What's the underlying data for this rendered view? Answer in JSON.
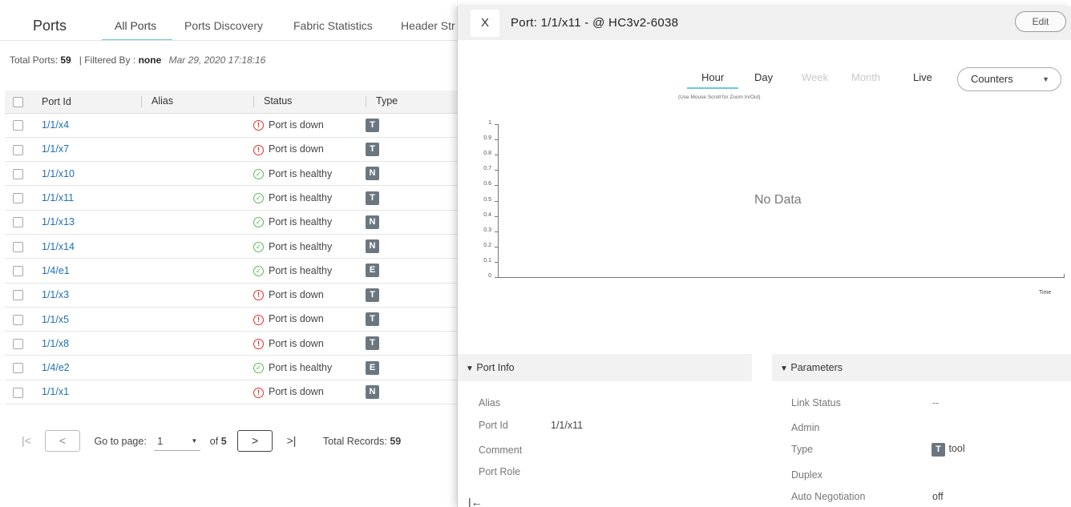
{
  "app": {
    "title": "Ports",
    "tabs": [
      "All Ports",
      "Ports Discovery",
      "Fabric Statistics",
      "Header Str"
    ],
    "summary": {
      "total_label": "Total Ports:",
      "total_value": "59",
      "filter_label": "| Filtered By :",
      "filter_value": "none",
      "timestamp": "Mar 29, 2020 17:18:16"
    }
  },
  "table": {
    "headers": {
      "port_id": "Port Id",
      "alias": "Alias",
      "status": "Status",
      "type": "Type"
    },
    "rows": [
      {
        "port": "1/1/x4",
        "status": "Port is down",
        "state": "down",
        "type": "T"
      },
      {
        "port": "1/1/x7",
        "status": "Port is down",
        "state": "down",
        "type": "T"
      },
      {
        "port": "1/1/x10",
        "status": "Port is healthy",
        "state": "ok",
        "type": "N"
      },
      {
        "port": "1/1/x11",
        "status": "Port is healthy",
        "state": "ok",
        "type": "T"
      },
      {
        "port": "1/1/x13",
        "status": "Port is healthy",
        "state": "ok",
        "type": "N"
      },
      {
        "port": "1/1/x14",
        "status": "Port is healthy",
        "state": "ok",
        "type": "N"
      },
      {
        "port": "1/4/e1",
        "status": "Port is healthy",
        "state": "ok",
        "type": "E"
      },
      {
        "port": "1/1/x3",
        "status": "Port is down",
        "state": "down",
        "type": "T"
      },
      {
        "port": "1/1/x5",
        "status": "Port is down",
        "state": "down",
        "type": "T"
      },
      {
        "port": "1/1/x8",
        "status": "Port is down",
        "state": "down",
        "type": "T"
      },
      {
        "port": "1/4/e2",
        "status": "Port is healthy",
        "state": "ok",
        "type": "E"
      },
      {
        "port": "1/1/x1",
        "status": "Port is down",
        "state": "down",
        "type": "N"
      }
    ]
  },
  "pager": {
    "goto_label": "Go to page:",
    "page": "1",
    "of_label": "of",
    "pages": "5",
    "total_label": "Total Records:",
    "total": "59"
  },
  "panel": {
    "close": "X",
    "title": "Port: 1/1/x11 - @ HC3v2-6038",
    "edit": "Edit",
    "time_tabs": {
      "hour": "Hour",
      "day": "Day",
      "week": "Week",
      "month": "Month",
      "live": "Live"
    },
    "counters": "Counters",
    "zoom_hint": "(Use Mouse Scroll for Zoom In/Out)",
    "no_data": "No Data",
    "time_axis": "Time",
    "port_info": {
      "heading": "Port Info",
      "alias_label": "Alias",
      "port_id_label": "Port Id",
      "port_id_value": "1/1/x11",
      "comment_label": "Comment",
      "role_label": "Port Role"
    },
    "parameters": {
      "heading": "Parameters",
      "link_status_label": "Link Status",
      "link_status_value": "--",
      "admin_label": "Admin",
      "type_label": "Type",
      "type_badge": "T",
      "type_value": "tool",
      "duplex_label": "Duplex",
      "autoneg_label": "Auto Negotiation",
      "autoneg_value": "off"
    }
  },
  "chart_data": {
    "type": "line",
    "title": "",
    "xlabel": "Time",
    "ylabel": "",
    "ylim": [
      0,
      1
    ],
    "y_ticks": [
      "0",
      "0.1",
      "0.2",
      "0.3",
      "0.4",
      "0.5",
      "0.6",
      "0.7",
      "0.8",
      "0.9",
      "1"
    ],
    "series": [],
    "annotation": "No Data"
  },
  "colors": {
    "accent": "#6cc9d8",
    "link": "#1f6fb2",
    "down": "#d9332b",
    "healthy": "#5cb85c",
    "badge": "#6b7780"
  }
}
